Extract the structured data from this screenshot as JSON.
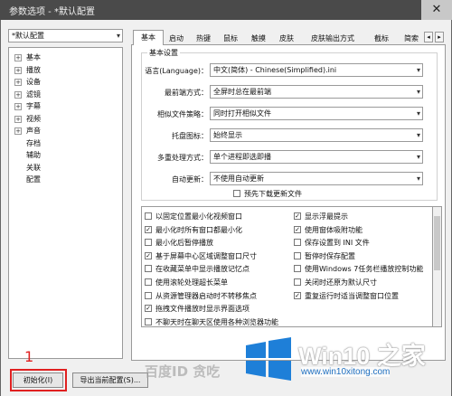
{
  "window": {
    "title": "参数选项 - *默认配置",
    "close_glyph": "✕"
  },
  "sidebar": {
    "preset": "*默认配置",
    "items": [
      {
        "label": "基本",
        "expandable": true
      },
      {
        "label": "播放",
        "expandable": true
      },
      {
        "label": "设备",
        "expandable": true
      },
      {
        "label": "滤镜",
        "expandable": true
      },
      {
        "label": "字幕",
        "expandable": true
      },
      {
        "label": "视频",
        "expandable": true
      },
      {
        "label": "声音",
        "expandable": true
      },
      {
        "label": "存档",
        "expandable": false
      },
      {
        "label": "辅助",
        "expandable": false
      },
      {
        "label": "关联",
        "expandable": false
      },
      {
        "label": "配置",
        "expandable": false
      }
    ]
  },
  "tabs": [
    "基本",
    "启动",
    "热键",
    "鼠标",
    "触摸",
    "皮肤",
    "皮肤输出方式",
    "截标",
    "简索"
  ],
  "active_tab": "基本",
  "basic": {
    "group_title": "基本设置",
    "language_label": "语言(Language)：",
    "language_value": "中文(简体) - Chinese(Simplified).ini",
    "fullscreen_label": "最前端方式：",
    "fullscreen_value": "全屏时总在最前端",
    "similar_label": "相似文件策略：",
    "similar_value": "同时打开相似文件",
    "tray_label": "托盘图标：",
    "tray_value": "始终显示",
    "multi_label": "多重处理方式：",
    "multi_value": "单个进程即选即播",
    "update_label": "自动更新：",
    "update_value": "不使用自动更新",
    "predownload_label": "预先下载更新文件"
  },
  "options_left": [
    {
      "label": "以固定位置最小化视频窗口",
      "checked": false
    },
    {
      "label": "最小化时所有窗口都最小化",
      "checked": true
    },
    {
      "label": "最小化后暂停播放",
      "checked": false
    },
    {
      "label": "基于屏幕中心区域调整窗口尺寸",
      "checked": true
    },
    {
      "label": "在收藏菜单中显示播放记忆点",
      "checked": false
    },
    {
      "label": "使用滚轮处理超长菜单",
      "checked": false
    },
    {
      "label": "从资源管理器启动时不转移焦点",
      "checked": false
    },
    {
      "label": "拖拽文件播放时显示界面选项",
      "checked": true
    },
    {
      "label": "不聊天时在聊天区使用各种浏览器功能",
      "checked": false
    }
  ],
  "options_right": [
    {
      "label": "显示浮最提示",
      "checked": true
    },
    {
      "label": "使用窗体吸附功能",
      "checked": true
    },
    {
      "label": "保存设置到 INI 文件",
      "checked": false
    },
    {
      "label": "暂停时保存配置",
      "checked": false
    },
    {
      "label": "使用Windows 7任务栏播放控制功能",
      "checked": false
    },
    {
      "label": "关闭时还原为默认尺寸",
      "checked": false
    },
    {
      "label": "重复运行时适当调整窗口位置",
      "checked": true
    }
  ],
  "buttons": {
    "init": "初始化(I)",
    "export": "导出当前配置(S)..."
  },
  "annotation": {
    "number": "1"
  },
  "watermark_text": "百度ID 贪吃",
  "brand": {
    "title": "Win10 之家",
    "url": "www.win10xitong.com"
  },
  "colors": {
    "brand_blue": "#1e6fc0",
    "annotation_red": "#e02020",
    "titlebar": "#4a4a4a"
  }
}
